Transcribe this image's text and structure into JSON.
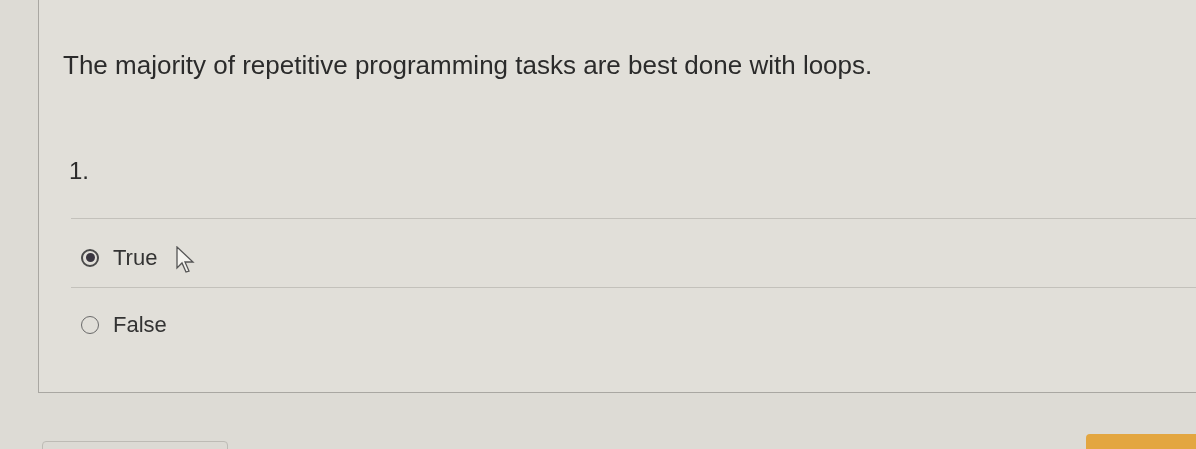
{
  "question": {
    "text": "The majority of repetitive programming tasks are best done with loops.",
    "number": "1."
  },
  "options": [
    {
      "label": "True",
      "selected": true
    },
    {
      "label": "False",
      "selected": false
    }
  ]
}
